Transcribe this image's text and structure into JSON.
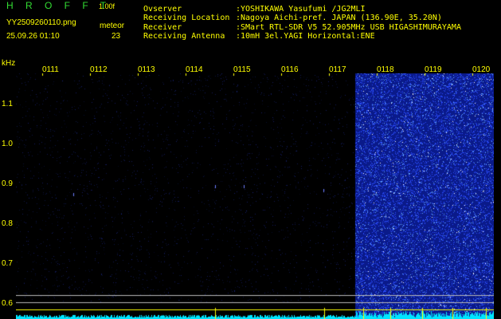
{
  "brand": {
    "name": "H R O F F T",
    "version": "1.00f"
  },
  "file": {
    "name": "YY2509260110.png",
    "timestamp": "25.09.26 01:10"
  },
  "meteor": {
    "label": "meteor",
    "count": "23"
  },
  "info": {
    "observer_label": "Ovserver",
    "observer_value": ":YOSHIKAWA Yasufumi /JG2MLI",
    "location_label": "Receiving Location",
    "location_value": ":Nagoya Aichi-pref. JAPAN (136.90E, 35.20N)",
    "receiver_label": "Receiver",
    "receiver_value": ":SMart RTL-SDR V5 52.905MHz USB HIGASHIMURAYAMA",
    "antenna_label": "Receiving Antenna",
    "antenna_value": ":10mH 3el.YAGI Horizontal:ENE"
  },
  "axis": {
    "unit": "kHz",
    "y_labels": [
      "1.1",
      "1.0",
      "0.9",
      "0.8",
      "0.7",
      "0.6"
    ],
    "time_labels": [
      "0111",
      "0112",
      "0113",
      "0114",
      "0115",
      "0116",
      "0117",
      "0118",
      "0119",
      "0120"
    ]
  },
  "colors": {
    "text": "#ffff00",
    "brand": "#33dd33",
    "noise": "#1a3cff",
    "background": "#000000",
    "baseline": "#00e5ff"
  }
}
